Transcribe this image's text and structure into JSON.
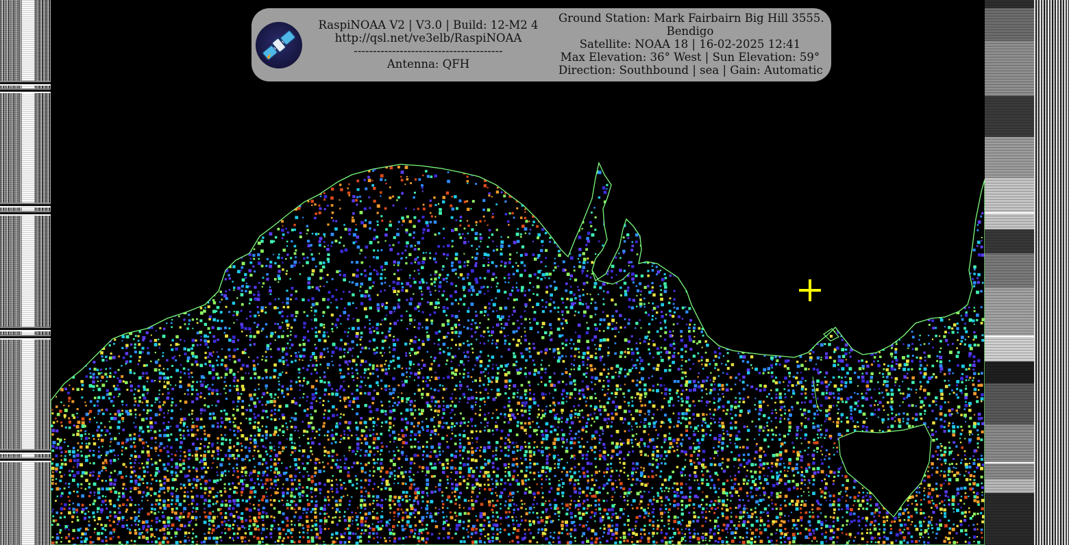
{
  "header": {
    "left": {
      "line1": "RaspiNOAA V2 | V3.0 | Build: 12-M2 4",
      "line2": "http://qsl.net/ve3elb/RaspiNOAA",
      "line3": "---------------------------------------",
      "line4": "Antenna: QFH"
    },
    "right": {
      "line1": "Ground Station: Mark Fairbairn Big Hill 3555.",
      "line2": "Bendigo",
      "line3": "Satellite: NOAA 18 | 16-02-2025 12:41",
      "line4": "Max Elevation: 36° West | Sun Elevation: 59°",
      "line5": "Direction: Southbound | sea | Gain: Automatic"
    }
  },
  "logo": {
    "icon": "satellite-icon"
  },
  "image": {
    "land_color": "#000000",
    "coast_color": "#7CFC7C",
    "crosshair_color": "#ffff00",
    "palette": [
      "#3b2bd8",
      "#5a3cf0",
      "#2f8cff",
      "#1fc8e8",
      "#3ff0b0",
      "#8ef060",
      "#e8e040",
      "#f09a2a",
      "#d84a1a"
    ]
  }
}
